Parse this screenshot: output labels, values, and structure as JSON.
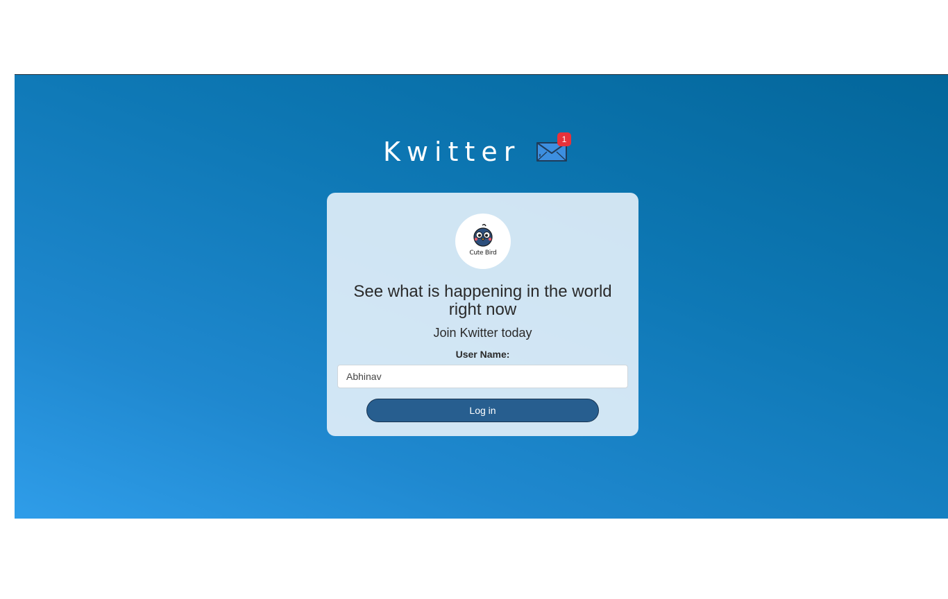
{
  "header": {
    "title": "Kwitter",
    "notification_count": "1"
  },
  "card": {
    "logo_text": "Cute Bird",
    "headline": "See what is happening in the world right now",
    "subline": "Join Kwitter today",
    "username_label": "User Name:",
    "username_value": "Abhinav",
    "login_label": "Log in"
  },
  "colors": {
    "gradient_dark": "#03669a",
    "gradient_light": "#2f9de9",
    "button_bg": "#275e8f",
    "badge_red": "#e8323a"
  }
}
